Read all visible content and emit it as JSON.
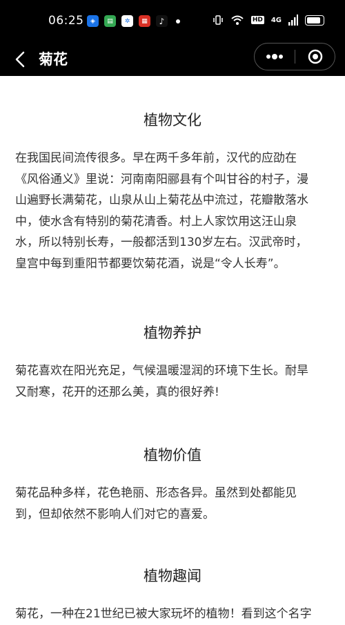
{
  "status_bar": {
    "time": "06:25",
    "app_icons": [
      {
        "name": "app-icon-1",
        "color": "#1a73e8"
      },
      {
        "name": "app-icon-2",
        "color": "#34a853"
      },
      {
        "name": "app-icon-3",
        "color": "#ffffff"
      },
      {
        "name": "app-icon-4",
        "color": "#d93025"
      },
      {
        "name": "tiktok-icon",
        "color": "#000000"
      }
    ],
    "hd_label": "HD",
    "network": "4G"
  },
  "nav": {
    "title": "菊花"
  },
  "sections": [
    {
      "title": "植物文化",
      "lines": [
        "在我国民间流传很多。早在两千多年前，汉代的应劭在",
        "《风俗通义》里说：河南南阳郦县有个叫甘谷的村子，漫",
        "山遍野长满菊花，山泉从山上菊花丛中流过，花瓣散落水",
        "中，使水含有特别的菊花清香。村上人家饮用这汪山泉",
        "水，所以特别长寿，一般都活到130岁左右。汉武帝时，",
        "皇宫中每到重阳节都要饮菊花酒，说是“令人长寿”。"
      ]
    },
    {
      "title": "植物养护",
      "lines": [
        "菊花喜欢在阳光充足，气候温暖湿润的环境下生长。耐旱",
        "又耐寒，花开的还那么美，真的很好养!"
      ]
    },
    {
      "title": "植物价值",
      "lines": [
        "菊花品种多样，花色艳丽、形态各异。虽然到处都能见",
        "到，但却依然不影响人们对它的喜爱。"
      ]
    },
    {
      "title": "植物趣闻",
      "lines": [
        "菊花，一种在21世纪已被大家玩坏的植物！看到这个名字"
      ]
    }
  ]
}
